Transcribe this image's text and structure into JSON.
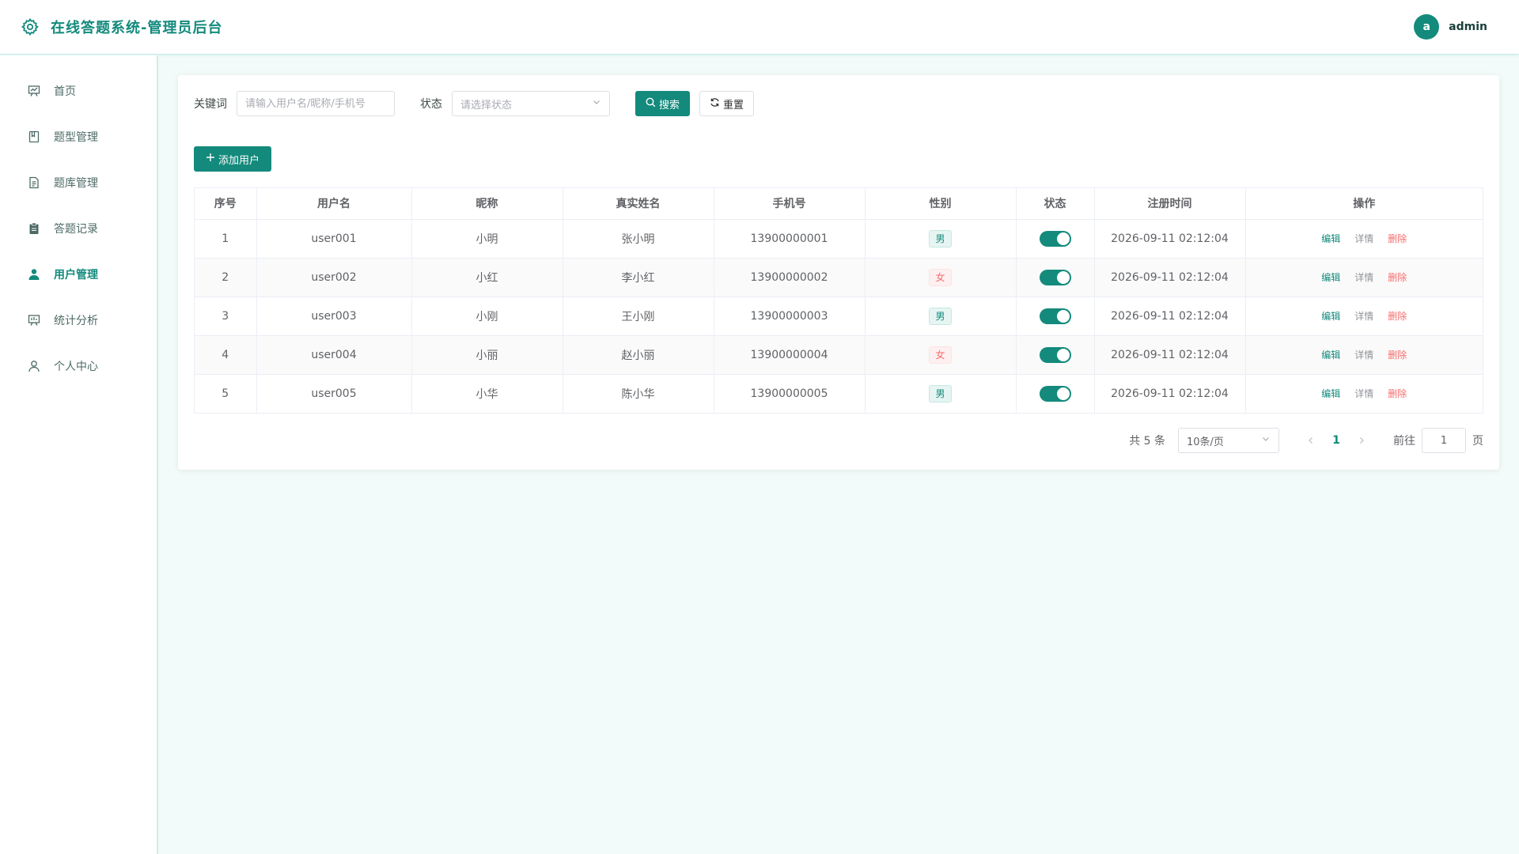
{
  "header": {
    "title": "在线答题系统-管理员后台",
    "avatar_letter": "a",
    "user_name": "admin"
  },
  "sidebar": {
    "items": [
      {
        "label": "首页",
        "icon": "presentation-chart-icon",
        "active": false
      },
      {
        "label": "题型管理",
        "icon": "notebook-icon",
        "active": false
      },
      {
        "label": "题库管理",
        "icon": "document-icon",
        "active": false
      },
      {
        "label": "答题记录",
        "icon": "clipboard-icon",
        "active": false
      },
      {
        "label": "用户管理",
        "icon": "user-filled-icon",
        "active": true
      },
      {
        "label": "统计分析",
        "icon": "presentation-icon",
        "active": false
      },
      {
        "label": "个人中心",
        "icon": "user-icon",
        "active": false
      }
    ]
  },
  "filters": {
    "keyword_label": "关键词",
    "keyword_placeholder": "请输入用户名/昵称/手机号",
    "keyword_value": "",
    "status_label": "状态",
    "status_placeholder": "请选择状态",
    "search_label": "搜索",
    "reset_label": "重置"
  },
  "toolbar": {
    "add_label": "添加用户"
  },
  "table": {
    "columns": [
      "序号",
      "用户名",
      "昵称",
      "真实姓名",
      "手机号",
      "性别",
      "状态",
      "注册时间",
      "操作"
    ],
    "rows": [
      {
        "index": "1",
        "username": "user001",
        "nickname": "小明",
        "realname": "张小明",
        "phone": "13900000001",
        "gender": "男",
        "enabled": true,
        "registered": "2026-09-11 02:12:04"
      },
      {
        "index": "2",
        "username": "user002",
        "nickname": "小红",
        "realname": "李小红",
        "phone": "13900000002",
        "gender": "女",
        "enabled": true,
        "registered": "2026-09-11 02:12:04"
      },
      {
        "index": "3",
        "username": "user003",
        "nickname": "小刚",
        "realname": "王小刚",
        "phone": "13900000003",
        "gender": "男",
        "enabled": true,
        "registered": "2026-09-11 02:12:04"
      },
      {
        "index": "4",
        "username": "user004",
        "nickname": "小丽",
        "realname": "赵小丽",
        "phone": "13900000004",
        "gender": "女",
        "enabled": true,
        "registered": "2026-09-11 02:12:04"
      },
      {
        "index": "5",
        "username": "user005",
        "nickname": "小华",
        "realname": "陈小华",
        "phone": "13900000005",
        "gender": "男",
        "enabled": true,
        "registered": "2026-09-11 02:12:04"
      }
    ],
    "actions": {
      "edit": "编辑",
      "detail": "详情",
      "delete": "删除"
    }
  },
  "pagination": {
    "total_text": "共 5 条",
    "page_size": "10条/页",
    "current_page": "1",
    "goto_prefix": "前往",
    "goto_value": "1",
    "goto_suffix": "页"
  },
  "colors": {
    "primary": "#138a7c",
    "danger": "#f56c6c",
    "background": "#f2fbf9"
  }
}
